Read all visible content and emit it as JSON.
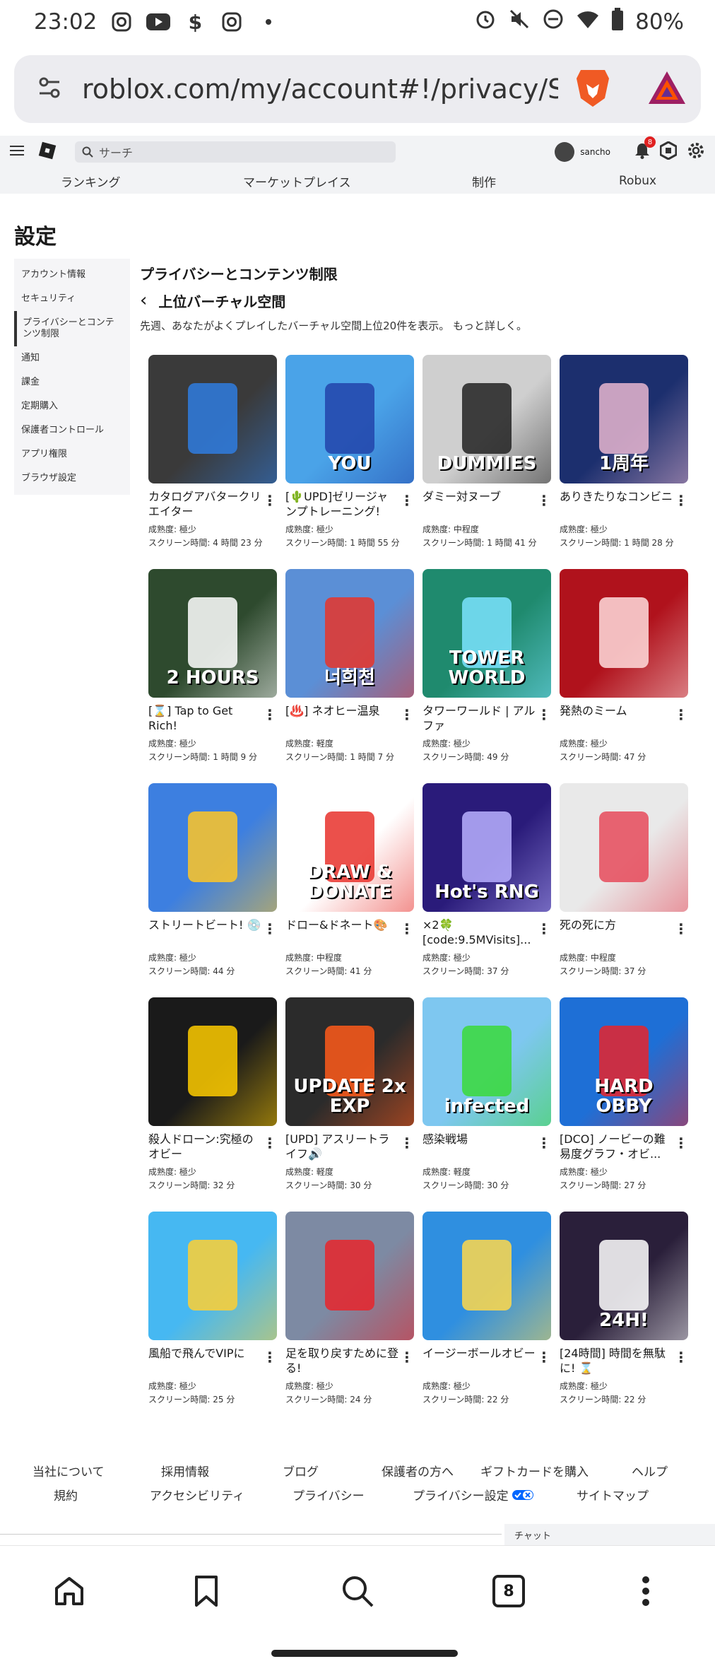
{
  "status": {
    "time": "23:02",
    "battery": "80%",
    "left_icons": [
      "instagram-icon",
      "youtube-icon",
      "dollar-icon",
      "instagram-icon",
      "dot-icon"
    ],
    "right_icons": [
      "alarm-icon",
      "mute-icon",
      "dnd-icon",
      "wifi-icon",
      "battery-icon"
    ]
  },
  "browser": {
    "url": "roblox.com/my/account#!/privacy/Scre",
    "tab_count": "8"
  },
  "header": {
    "search_placeholder": "サーチ",
    "username": "sancho",
    "notification_count": "8",
    "nav": [
      "ランキング",
      "マーケットプレイス",
      "制作",
      "Robux"
    ]
  },
  "page": {
    "title": "設定",
    "section_title": "プライバシーとコンテンツ制限",
    "sub_title": "上位バーチャル空間",
    "description": "先週、あなたがよくプレイしたバーチャル空間上位20件を表示。 もっと詳しく。"
  },
  "sidebar": {
    "items": [
      "アカウント情報",
      "セキュリティ",
      "プライバシーとコンテンツ制限",
      "通知",
      "課金",
      "定期購入",
      "保護者コントロール",
      "アプリ権限",
      "ブラウザ設定"
    ]
  },
  "labels": {
    "maturity_prefix": "成熟度: ",
    "screen_prefix": "スクリーン時間: "
  },
  "games": [
    {
      "title": "カタログアバタークリエイター",
      "maturity": "極少",
      "time": "4 時間 23 分",
      "thumb_text": "",
      "bg": "#3a3a3a",
      "accent": "#2f7de1"
    },
    {
      "title": "[🌵UPD]ゼリージャンプトレーニング!",
      "maturity": "極少",
      "time": "1 時間 55 分",
      "thumb_text": "YOU",
      "bg": "#4aa3e8",
      "accent": "#2244aa"
    },
    {
      "title": "ダミー対ヌーブ",
      "maturity": "中程度",
      "time": "1 時間 41 分",
      "thumb_text": "DUMMIES",
      "bg": "#cfcfcf",
      "accent": "#222222"
    },
    {
      "title": "ありきたりなコンビニ",
      "maturity": "極少",
      "time": "1 時間 28 分",
      "thumb_text": "1周年",
      "bg": "#1c2f6e",
      "accent": "#e8b6d0"
    },
    {
      "title": "[⌛] Tap to Get Rich!",
      "maturity": "極少",
      "time": "1 時間 9 分",
      "thumb_text": "2 HOURS",
      "bg": "#2e4a2e",
      "accent": "#ffffff"
    },
    {
      "title": "[♨️] ネオヒー温泉",
      "maturity": "軽度",
      "time": "1 時間 7 分",
      "thumb_text": "너희천",
      "bg": "#5b8fd6",
      "accent": "#e8352a"
    },
    {
      "title": "タワーワールド | アルファ",
      "maturity": "極少",
      "time": "49 分",
      "thumb_text": "TOWER WORLD",
      "bg": "#1f8a6e",
      "accent": "#7be3ff"
    },
    {
      "title": "発熱のミーム",
      "maturity": "極少",
      "time": "47 分",
      "thumb_text": "",
      "bg": "#b0121c",
      "accent": "#ffdddd"
    },
    {
      "title": "ストリートビート! 💿",
      "maturity": "極少",
      "time": "44 分",
      "thumb_text": "",
      "bg": "#3d7fe0",
      "accent": "#ffc524"
    },
    {
      "title": "ドロー&ドネート🎨",
      "maturity": "中程度",
      "time": "41 分",
      "thumb_text": "DRAW & DONATE",
      "bg": "#ffffff",
      "accent": "#e8312c"
    },
    {
      "title": "×2🍀 [code:9.5MVisits]...",
      "maturity": "極少",
      "time": "37 分",
      "thumb_text": "Hot's RNG",
      "bg": "#2a1b7a",
      "accent": "#b8b0ff"
    },
    {
      "title": "死の死に方",
      "maturity": "中程度",
      "time": "37 分",
      "thumb_text": "",
      "bg": "#e9e9e9",
      "accent": "#e64a5a"
    },
    {
      "title": "殺人ドローン:究極のオビー",
      "maturity": "極少",
      "time": "32 分",
      "thumb_text": "",
      "bg": "#1a1a1a",
      "accent": "#ffcc00"
    },
    {
      "title": "[UPD] アスリートライフ🔊",
      "maturity": "軽度",
      "time": "30 分",
      "thumb_text": "UPDATE 2x EXP",
      "bg": "#2b2b2b",
      "accent": "#ff5a1a"
    },
    {
      "title": "感染戦場",
      "maturity": "軽度",
      "time": "30 分",
      "thumb_text": "infected",
      "bg": "#7ec7f0",
      "accent": "#3ad93a"
    },
    {
      "title": "[DCO] ノービーの難易度グラフ・オビ...",
      "maturity": "極少",
      "time": "27 分",
      "thumb_text": "HARD OBBY",
      "bg": "#1e6fd6",
      "accent": "#e8242c"
    },
    {
      "title": "風船で飛んでVIPに",
      "maturity": "極少",
      "time": "25 分",
      "thumb_text": "",
      "bg": "#46b8f2",
      "accent": "#ffcf33"
    },
    {
      "title": "足を取り戻すために登る!",
      "maturity": "極少",
      "time": "24 分",
      "thumb_text": "",
      "bg": "#7d8aa3",
      "accent": "#e8242c"
    },
    {
      "title": "イージーボールオビー",
      "maturity": "極少",
      "time": "22 分",
      "thumb_text": "",
      "bg": "#2f8fe0",
      "accent": "#ffd84a"
    },
    {
      "title": "[24時間] 時間を無駄に! ⌛",
      "maturity": "極少",
      "time": "22 分",
      "thumb_text": "24H!",
      "bg": "#2a1f3a",
      "accent": "#ffffff"
    }
  ],
  "footer": {
    "row1": [
      "当社について",
      "採用情報",
      "ブログ",
      "保護者の方へ",
      "ギフトカードを購入",
      "ヘルプ"
    ],
    "row2": [
      "規約",
      "アクセシビリティ",
      "プライバシー",
      "プライバシー設定",
      "サイトマップ"
    ],
    "chat": "チャット"
  }
}
